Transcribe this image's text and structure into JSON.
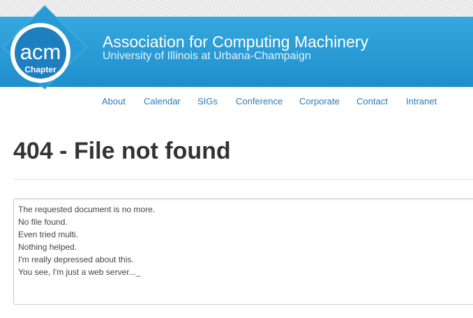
{
  "header": {
    "logo": {
      "main_text": "acm",
      "sub_text": "Chapter"
    },
    "title": "Association for Computing Machinery",
    "subtitle": "University of Illinois at Urbana-Champaign",
    "colors": {
      "banner_top": "#35a8de",
      "banner_bottom": "#1f8fcc",
      "logo_diamond": "#2a9ad6"
    }
  },
  "nav": {
    "items": [
      {
        "label": "About"
      },
      {
        "label": "Calendar"
      },
      {
        "label": "SIGs"
      },
      {
        "label": "Conference"
      },
      {
        "label": "Corporate"
      },
      {
        "label": "Contact"
      },
      {
        "label": "Intranet"
      }
    ],
    "link_color": "#2a7ab8"
  },
  "main": {
    "heading": "404 - File not found",
    "console": {
      "lines": [
        "The requested document is no more.",
        "No file found.",
        "Even tried multi.",
        "Nothing helped.",
        "I'm really depressed about this.",
        "You see, I'm just a web server..._"
      ]
    }
  }
}
